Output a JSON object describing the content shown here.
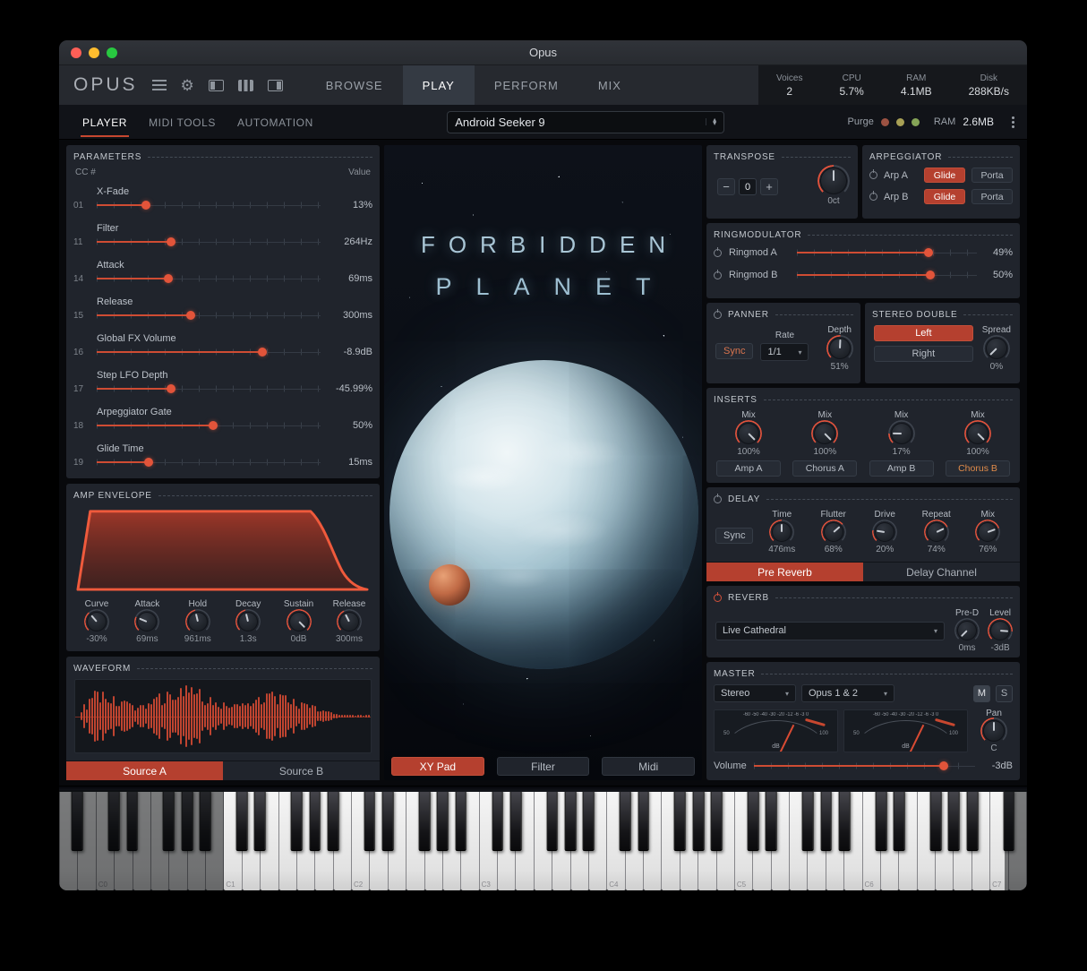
{
  "accent": "#c7472f",
  "window": {
    "title": "Opus"
  },
  "toolbar": {
    "logo": "OPUS",
    "tabs": [
      {
        "label": "BROWSE",
        "active": false
      },
      {
        "label": "PLAY",
        "active": true
      },
      {
        "label": "PERFORM",
        "active": false
      },
      {
        "label": "MIX",
        "active": false
      }
    ],
    "stats": [
      {
        "label": "Voices",
        "value": "2"
      },
      {
        "label": "CPU",
        "value": "5.7%"
      },
      {
        "label": "RAM",
        "value": "4.1MB"
      },
      {
        "label": "Disk",
        "value": "288KB/s"
      }
    ]
  },
  "subtoolbar": {
    "tabs": [
      {
        "label": "PLAYER",
        "active": true
      },
      {
        "label": "MIDI TOOLS",
        "active": false
      },
      {
        "label": "AUTOMATION",
        "active": false
      }
    ],
    "preset": "Android Seeker 9",
    "purge_label": "Purge",
    "ram_label": "RAM",
    "ram_value": "2.6MB"
  },
  "parameters": {
    "title": "PARAMETERS",
    "col_cc": "CC #",
    "col_value": "Value",
    "rows": [
      {
        "cc": "01",
        "label": "X-Fade",
        "value": "13%",
        "pct": 22
      },
      {
        "cc": "11",
        "label": "Filter",
        "value": "264Hz",
        "pct": 33
      },
      {
        "cc": "14",
        "label": "Attack",
        "value": "69ms",
        "pct": 32
      },
      {
        "cc": "15",
        "label": "Release",
        "value": "300ms",
        "pct": 42
      },
      {
        "cc": "16",
        "label": "Global FX Volume",
        "value": "-8.9dB",
        "pct": 74
      },
      {
        "cc": "17",
        "label": "Step LFO Depth",
        "value": "-45.99%",
        "pct": 33
      },
      {
        "cc": "18",
        "label": "Arpeggiator Gate",
        "value": "50%",
        "pct": 52
      },
      {
        "cc": "19",
        "label": "Glide Time",
        "value": "15ms",
        "pct": 23
      }
    ]
  },
  "amp_envelope": {
    "title": "AMP ENVELOPE",
    "knobs": [
      {
        "label": "Curve",
        "value": "-30%",
        "pct": 35
      },
      {
        "label": "Attack",
        "value": "69ms",
        "pct": 25
      },
      {
        "label": "Hold",
        "value": "961ms",
        "pct": 45
      },
      {
        "label": "Decay",
        "value": "1.3s",
        "pct": 45
      },
      {
        "label": "Sustain",
        "value": "0dB",
        "pct": 100
      },
      {
        "label": "Release",
        "value": "300ms",
        "pct": 40
      }
    ]
  },
  "waveform": {
    "title": "WAVEFORM",
    "sources": [
      {
        "label": "Source A",
        "active": true
      },
      {
        "label": "Source B",
        "active": false
      }
    ]
  },
  "artwork": {
    "title_line1": "FORBIDDEN",
    "title_line2": "PLANET"
  },
  "center_buttons": [
    {
      "label": "XY Pad",
      "active": true
    },
    {
      "label": "Filter",
      "active": false
    },
    {
      "label": "Midi",
      "active": false
    }
  ],
  "transpose": {
    "title": "TRANSPOSE",
    "minus": "−",
    "value": "0",
    "plus": "+",
    "knob_value": "0ct",
    "pct": 50
  },
  "arpeggiator": {
    "title": "ARPEGGIATOR",
    "rows": [
      {
        "label": "Arp A",
        "glide": "Glide",
        "porta": "Porta"
      },
      {
        "label": "Arp B",
        "glide": "Glide",
        "porta": "Porta"
      }
    ]
  },
  "ringmodulator": {
    "title": "RINGMODULATOR",
    "rows": [
      {
        "label": "Ringmod A",
        "value": "49%",
        "pct": 73
      },
      {
        "label": "Ringmod B",
        "value": "50%",
        "pct": 74
      }
    ]
  },
  "panner": {
    "title": "PANNER",
    "sync": "Sync",
    "rate_label": "Rate",
    "rate_value": "1/1",
    "depth_label": "Depth",
    "depth_value": "51%",
    "depth_pct": 51
  },
  "stereo_double": {
    "title": "STEREO DOUBLE",
    "left": "Left",
    "right": "Right",
    "spread_label": "Spread",
    "spread_value": "0%",
    "spread_pct": 0
  },
  "inserts": {
    "title": "INSERTS",
    "slots": [
      {
        "mix_label": "Mix",
        "value": "100%",
        "pct": 100,
        "name": "Amp A",
        "active": false
      },
      {
        "mix_label": "Mix",
        "value": "100%",
        "pct": 100,
        "name": "Chorus A",
        "active": false
      },
      {
        "mix_label": "Mix",
        "value": "17%",
        "pct": 17,
        "name": "Amp B",
        "active": false
      },
      {
        "mix_label": "Mix",
        "value": "100%",
        "pct": 100,
        "name": "Chorus B",
        "active": true
      }
    ]
  },
  "delay": {
    "title": "DELAY",
    "sync": "Sync",
    "knobs": [
      {
        "label": "Time",
        "value": "476ms",
        "pct": 50
      },
      {
        "label": "Flutter",
        "value": "68%",
        "pct": 68
      },
      {
        "label": "Drive",
        "value": "20%",
        "pct": 20
      },
      {
        "label": "Repeat",
        "value": "74%",
        "pct": 74
      },
      {
        "label": "Mix",
        "value": "76%",
        "pct": 76
      }
    ],
    "tabs": [
      {
        "label": "Pre Reverb",
        "active": true
      },
      {
        "label": "Delay Channel",
        "active": false
      }
    ]
  },
  "reverb": {
    "title": "REVERB",
    "preset": "Live Cathedral",
    "knobs": [
      {
        "label": "Pre-D",
        "value": "0ms",
        "pct": 0
      },
      {
        "label": "Level",
        "value": "-3dB",
        "pct": 85
      }
    ]
  },
  "master": {
    "title": "MASTER",
    "output_select": "Stereo",
    "channel_select": "Opus 1 & 2",
    "mute": "M",
    "solo": "S",
    "meter_scale": "-60 -50 -40 -30 -20 -12 -6 -3 0",
    "meter_sub_left": "50",
    "meter_sub_right": "100",
    "meter_unit": "dB",
    "pan_label": "Pan",
    "pan_value": "C",
    "pan_pct": 50,
    "volume_label": "Volume",
    "volume_value": "-3dB",
    "volume_pct": 86
  },
  "keyboard": {
    "octave_labels": [
      "C0",
      "C1",
      "C2",
      "C3",
      "C4",
      "C5",
      "C6",
      "C7"
    ]
  }
}
